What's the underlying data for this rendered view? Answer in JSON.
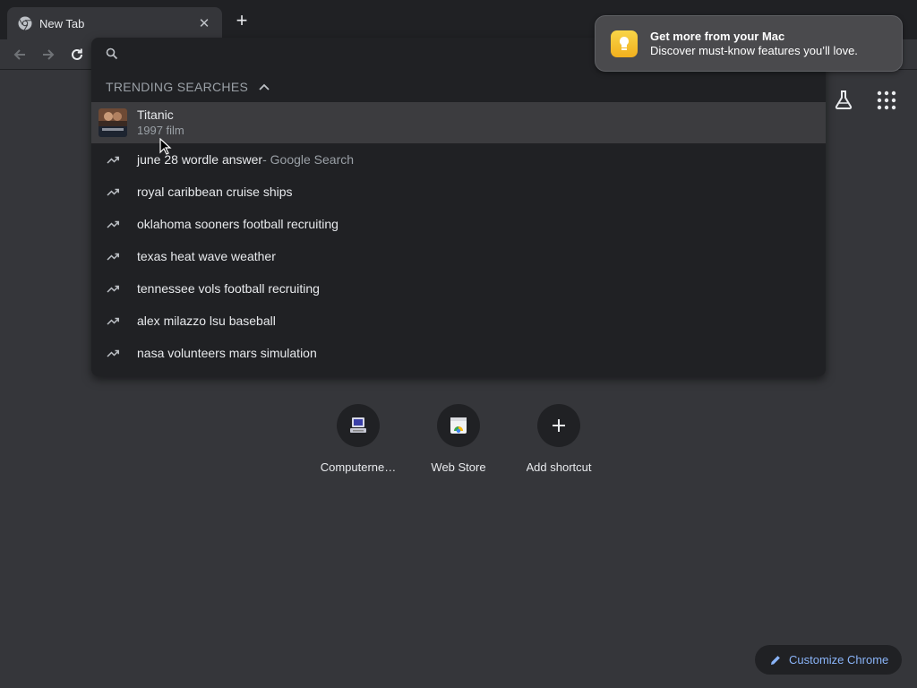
{
  "tab": {
    "title": "New Tab",
    "favicon": "chrome-icon",
    "close": "✕"
  },
  "new_tab_symbol": "+",
  "toolbar": {
    "back": "back-arrow-icon",
    "forward": "forward-arrow-icon",
    "reload": "reload-icon"
  },
  "omnibox": {
    "placeholder": "",
    "trending_label": "TRENDING SEARCHES",
    "rich_suggestion": {
      "title": "Titanic",
      "subtitle": "1997 film"
    },
    "suggestions": [
      {
        "text": "june 28 wordle answer",
        "suffix": " - Google Search"
      },
      {
        "text": "royal caribbean cruise ships",
        "suffix": ""
      },
      {
        "text": "oklahoma sooners football recruiting",
        "suffix": ""
      },
      {
        "text": "texas heat wave weather",
        "suffix": ""
      },
      {
        "text": "tennessee vols football recruiting",
        "suffix": ""
      },
      {
        "text": "alex milazzo lsu baseball",
        "suffix": ""
      },
      {
        "text": "nasa volunteers mars simulation",
        "suffix": ""
      }
    ]
  },
  "notification": {
    "title": "Get more from your Mac",
    "body": "Discover must-know features you’ll love."
  },
  "shortcuts": [
    {
      "label": "Computerne…",
      "icon": "computer-icon"
    },
    {
      "label": "Web Store",
      "icon": "web-store-icon"
    },
    {
      "label": "Add shortcut",
      "icon": "plus-icon"
    }
  ],
  "customize": {
    "label": "Customize Chrome"
  },
  "colors": {
    "background": "#35363a",
    "dropdown": "#202124",
    "accent": "#8ab4f8",
    "highlight_row": "#3c3c3f"
  }
}
